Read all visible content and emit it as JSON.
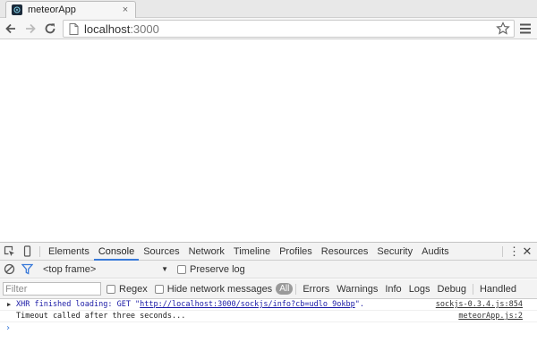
{
  "tab": {
    "title": "meteorApp",
    "close": "×"
  },
  "omnibox": {
    "host": "localhost",
    "port": ":3000"
  },
  "devtools": {
    "tabs": [
      "Elements",
      "Console",
      "Sources",
      "Network",
      "Timeline",
      "Profiles",
      "Resources",
      "Security",
      "Audits"
    ],
    "active_tab": "Console",
    "kebab": "⋮",
    "close": "✕",
    "frame": "<top frame>",
    "frame_caret": "▼",
    "preserve_log": "Preserve log",
    "filter_placeholder": "Filter",
    "regex": "Regex",
    "hide_network": "Hide network messages",
    "levels": [
      "All",
      "Errors",
      "Warnings",
      "Info",
      "Logs",
      "Debug",
      "Handled"
    ]
  },
  "console": {
    "messages": [
      {
        "prefix": "XHR finished loading: GET \"",
        "url": "http://localhost:3000/sockjs/info?cb=udlo_9okbp",
        "suffix": "\".",
        "source": "sockjs-0.3.4.js:854"
      },
      {
        "text": "Timeout called after three seconds...",
        "source": "meteorApp.js:2"
      }
    ],
    "prompt": "›"
  },
  "colors": {
    "accent": "#3879d9",
    "link": "#1a1aa6"
  }
}
